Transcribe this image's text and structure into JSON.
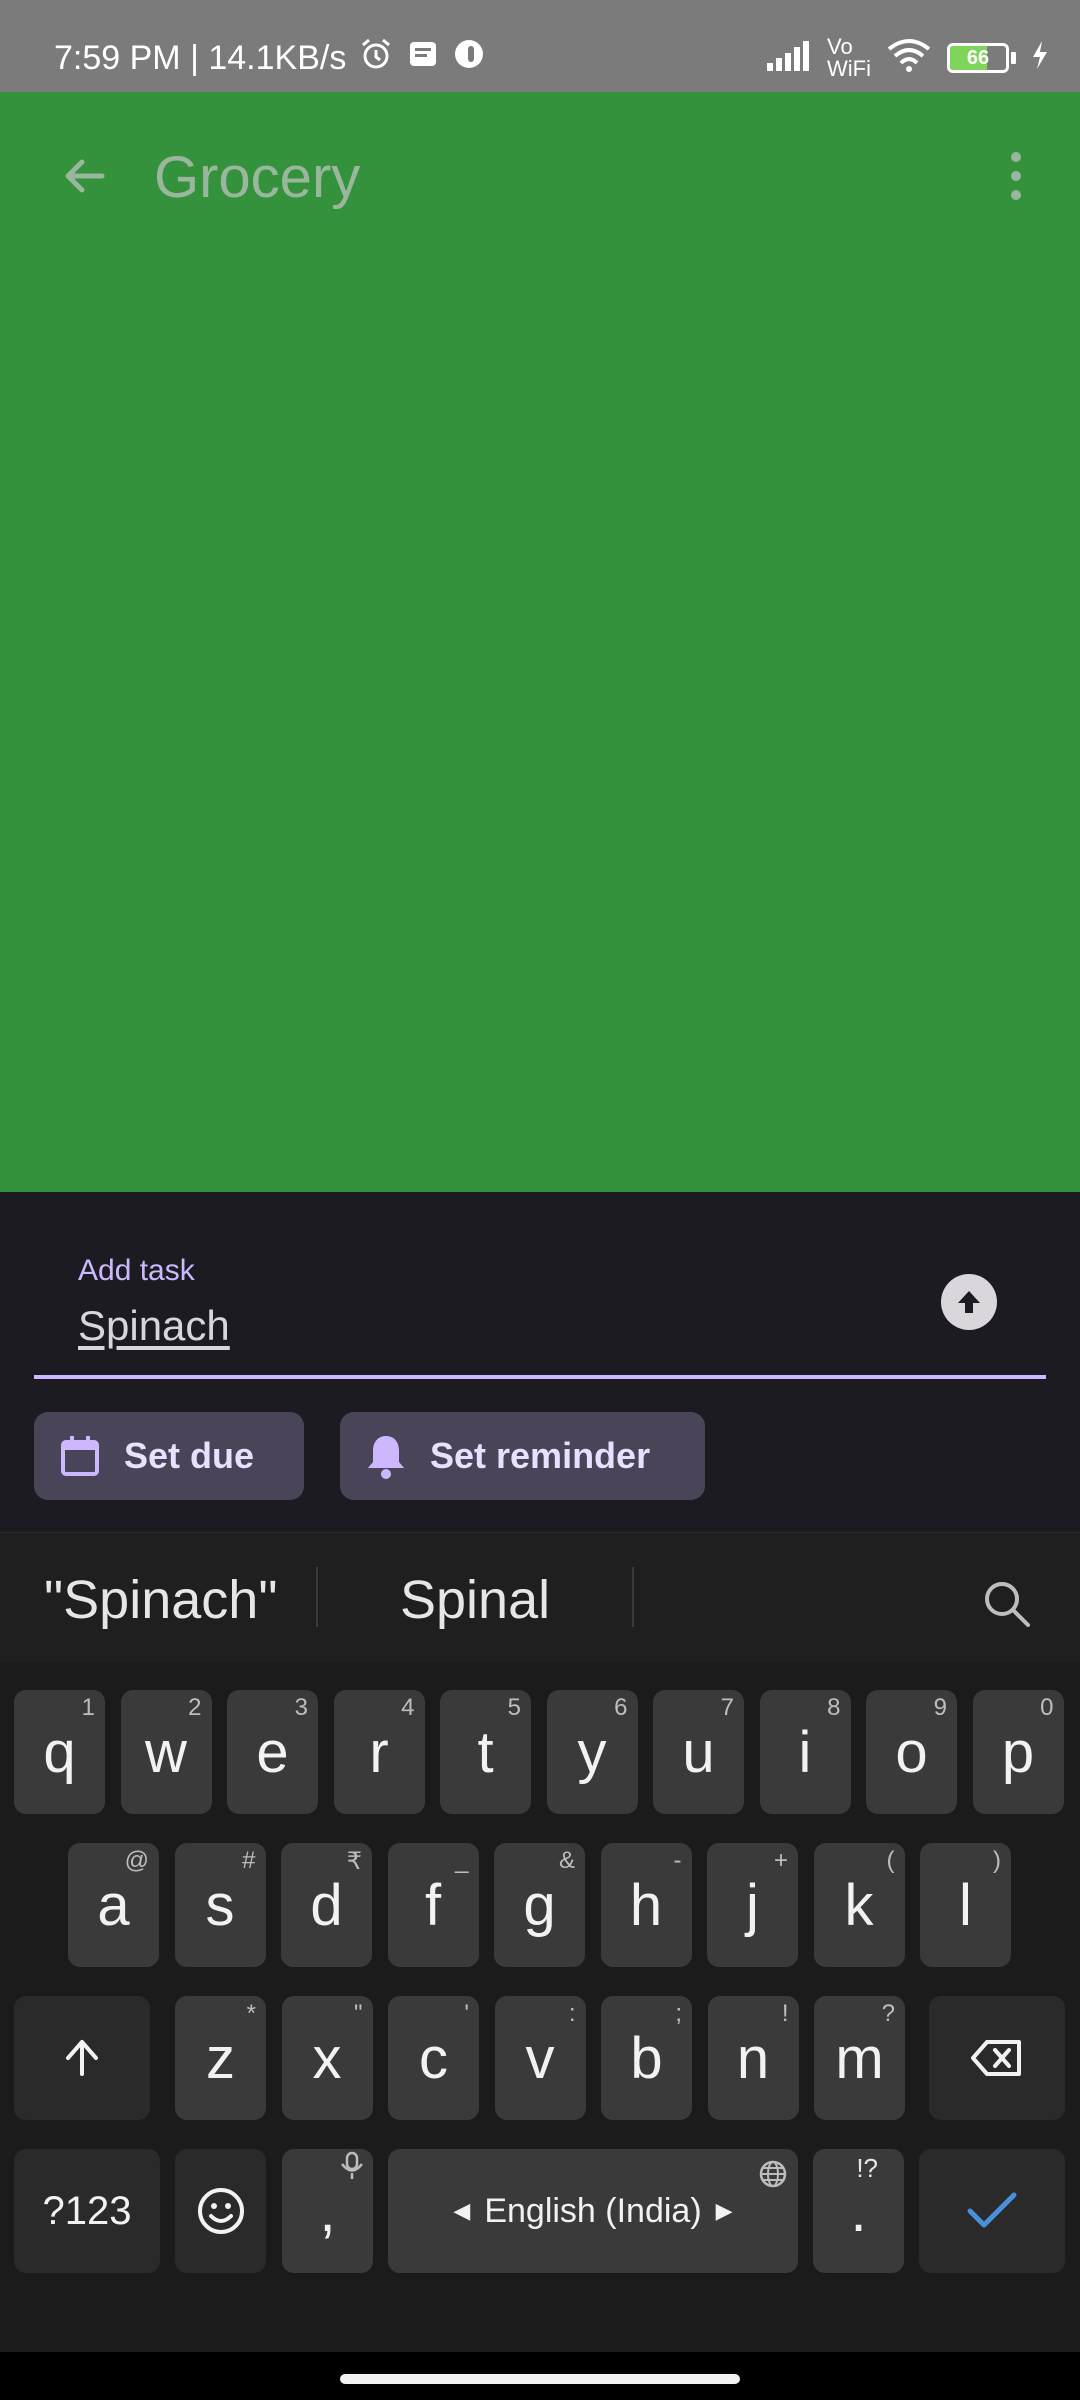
{
  "status_bar": {
    "time_speed": "7:59 PM | 14.1KB/s",
    "network_label": "Vo WiFi",
    "battery_level": "66",
    "icons": [
      "alarm-icon",
      "message-icon",
      "app-icon",
      "signal-icon",
      "wifi-icon",
      "battery-icon",
      "charging-icon"
    ]
  },
  "app": {
    "title": "Grocery",
    "background_color": "#34923c"
  },
  "task_entry": {
    "label": "Add task",
    "value": "Spinach",
    "chips": {
      "due": "Set due",
      "reminder": "Set reminder"
    }
  },
  "keyboard": {
    "suggestions": [
      "\"Spinach\"",
      "Spinal"
    ],
    "row1": [
      {
        "k": "q",
        "h": "1"
      },
      {
        "k": "w",
        "h": "2"
      },
      {
        "k": "e",
        "h": "3"
      },
      {
        "k": "r",
        "h": "4"
      },
      {
        "k": "t",
        "h": "5"
      },
      {
        "k": "y",
        "h": "6"
      },
      {
        "k": "u",
        "h": "7"
      },
      {
        "k": "i",
        "h": "8"
      },
      {
        "k": "o",
        "h": "9"
      },
      {
        "k": "p",
        "h": "0"
      }
    ],
    "row2": [
      {
        "k": "a",
        "h": "@"
      },
      {
        "k": "s",
        "h": "#"
      },
      {
        "k": "d",
        "h": "₹"
      },
      {
        "k": "f",
        "h": "_"
      },
      {
        "k": "g",
        "h": "&"
      },
      {
        "k": "h",
        "h": "-"
      },
      {
        "k": "j",
        "h": "+"
      },
      {
        "k": "k",
        "h": "("
      },
      {
        "k": "l",
        "h": ")"
      }
    ],
    "row3": [
      {
        "k": "z",
        "h": "*"
      },
      {
        "k": "x",
        "h": "\""
      },
      {
        "k": "c",
        "h": "'"
      },
      {
        "k": "v",
        "h": ":"
      },
      {
        "k": "b",
        "h": ";"
      },
      {
        "k": "n",
        "h": "!"
      },
      {
        "k": "m",
        "h": "?"
      }
    ],
    "symbols_key": "?123",
    "comma_key": ",",
    "period_key": ".",
    "period_hint": "!?",
    "space_label": "English (India)"
  }
}
